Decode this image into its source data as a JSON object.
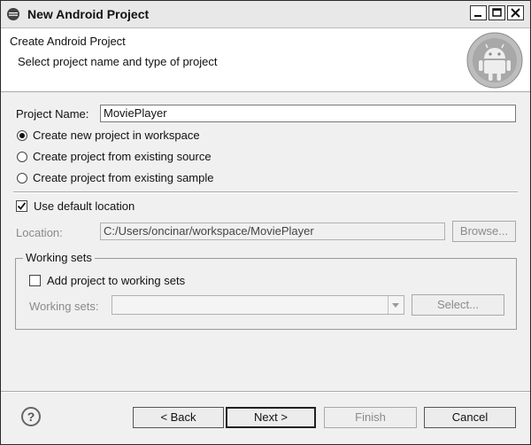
{
  "window": {
    "title": "New Android Project"
  },
  "header": {
    "title": "Create Android Project",
    "subtitle": "Select project name and type of project",
    "logo_icon": "android-logo-icon"
  },
  "form": {
    "project_name_label": "Project Name:",
    "project_name_value": "MoviePlayer",
    "radio_options": [
      {
        "label": "Create new project in workspace",
        "selected": true
      },
      {
        "label": "Create project from existing source",
        "selected": false
      },
      {
        "label": "Create project from existing sample",
        "selected": false
      }
    ],
    "use_default_location_label": "Use default location",
    "use_default_location_checked": true,
    "location_label": "Location:",
    "location_value": "C:/Users/oncinar/workspace/MoviePlayer",
    "browse_button": "Browse..."
  },
  "working_sets": {
    "group_label": "Working sets",
    "add_checkbox_label": "Add project to working sets",
    "add_checkbox_checked": false,
    "working_sets_label": "Working sets:",
    "working_sets_value": "",
    "select_button": "Select..."
  },
  "footer": {
    "help_icon": "help-icon",
    "back_button": "< Back",
    "next_button": "Next >",
    "finish_button": "Finish",
    "cancel_button": "Cancel"
  }
}
